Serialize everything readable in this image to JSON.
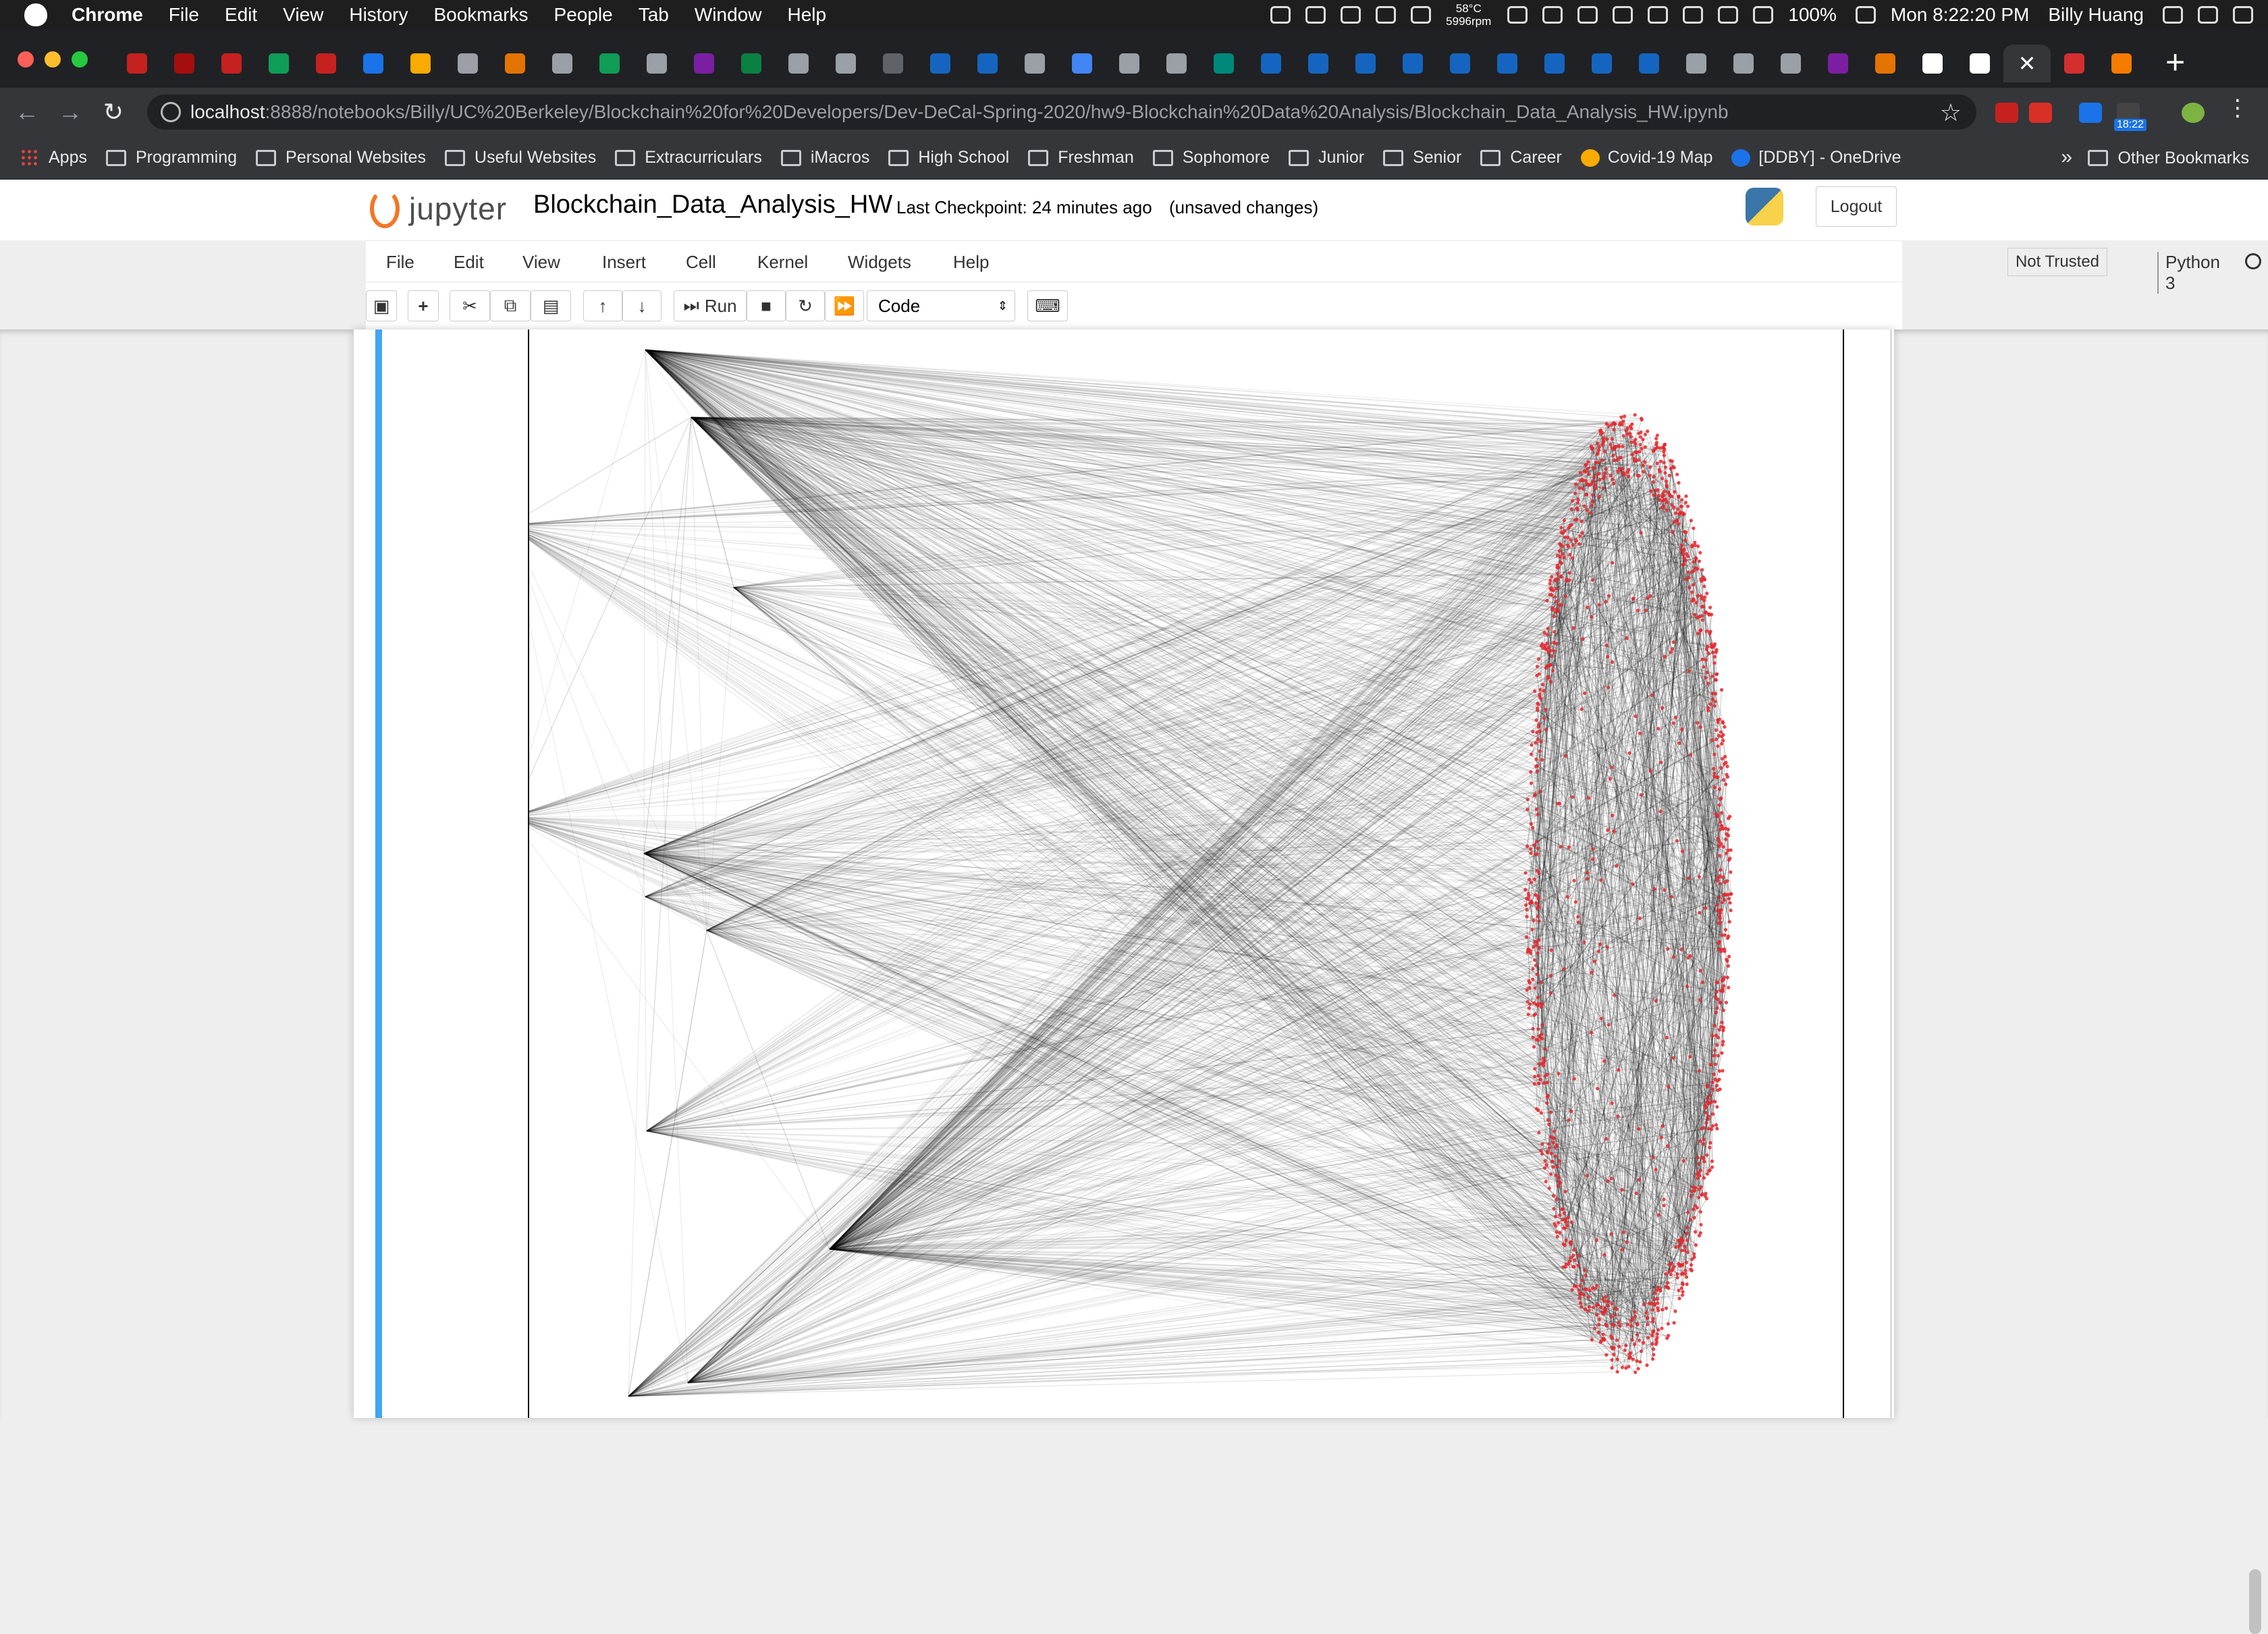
{
  "macos_menubar": {
    "app": "Chrome",
    "items": [
      "File",
      "Edit",
      "View",
      "History",
      "Bookmarks",
      "People",
      "Tab",
      "Window",
      "Help"
    ],
    "temperature": "58°C",
    "fan": "5996rpm",
    "battery": "100%",
    "datetime": "Mon 8:22:20 PM",
    "user": "Billy Huang"
  },
  "browser": {
    "url_host": "localhost",
    "url_path": ":8888/notebooks/Billy/UC%20Berkeley/Blockchain%20for%20Developers/Dev-DeCal-Spring-2020/hw9-Blockchain%20Data%20Analysis/Blockchain_Data_Analysis_HW.ipynb",
    "ext_badge": "18:22",
    "bookmarks": [
      "Programming",
      "Personal Websites",
      "Useful Websites",
      "Extracurriculars",
      "iMacros",
      "High School",
      "Freshman",
      "Sophomore",
      "Junior",
      "Senior",
      "Career",
      "Covid-19 Map",
      "[DDBY] - OneDrive"
    ],
    "apps_label": "Apps",
    "more_label": "»",
    "other_bookmarks": "Other Bookmarks",
    "tab_fav_colors": [
      "#c5221f",
      "#a50e0e",
      "#c5221f",
      "#0f9d58",
      "#c5221f",
      "#1a73e8",
      "#f9ab00",
      "#9aa0a6",
      "#e37400",
      "#9aa0a6",
      "#0f9d58",
      "#9aa0a6",
      "#7b1fa2",
      "#0b8043",
      "#9aa0a6",
      "#9aa0a6",
      "#5f6368",
      "#1565c0",
      "#1565c0",
      "#9aa0a6",
      "#4285f4",
      "#9aa0a6",
      "#9aa0a6",
      "#00897b",
      "#1565c0",
      "#1565c0",
      "#1565c0",
      "#1565c0",
      "#1565c0",
      "#1565c0",
      "#1565c0",
      "#1565c0",
      "#1565c0",
      "#9aa0a6",
      "#9aa0a6",
      "#9aa0a6",
      "#7b1fa2",
      "#e37400",
      "#ffffff",
      "#ffffff",
      "#d32f2f",
      "#f57c00"
    ]
  },
  "jupyter": {
    "brand": "jupyter",
    "title": "Blockchain_Data_Analysis_HW",
    "checkpoint": "Last Checkpoint: 24 minutes ago",
    "unsaved": "(unsaved changes)",
    "logout": "Logout",
    "menu": [
      "File",
      "Edit",
      "View",
      "Insert",
      "Cell",
      "Kernel",
      "Widgets",
      "Help"
    ],
    "trusted": "Not Trusted",
    "kernel": "Python 3",
    "run_label": "Run",
    "cell_type": "Code"
  },
  "graph": {
    "edge_color": "#000000",
    "node_color": "#e8262b",
    "description_colors": [
      "#000000",
      "#e8262b"
    ]
  }
}
